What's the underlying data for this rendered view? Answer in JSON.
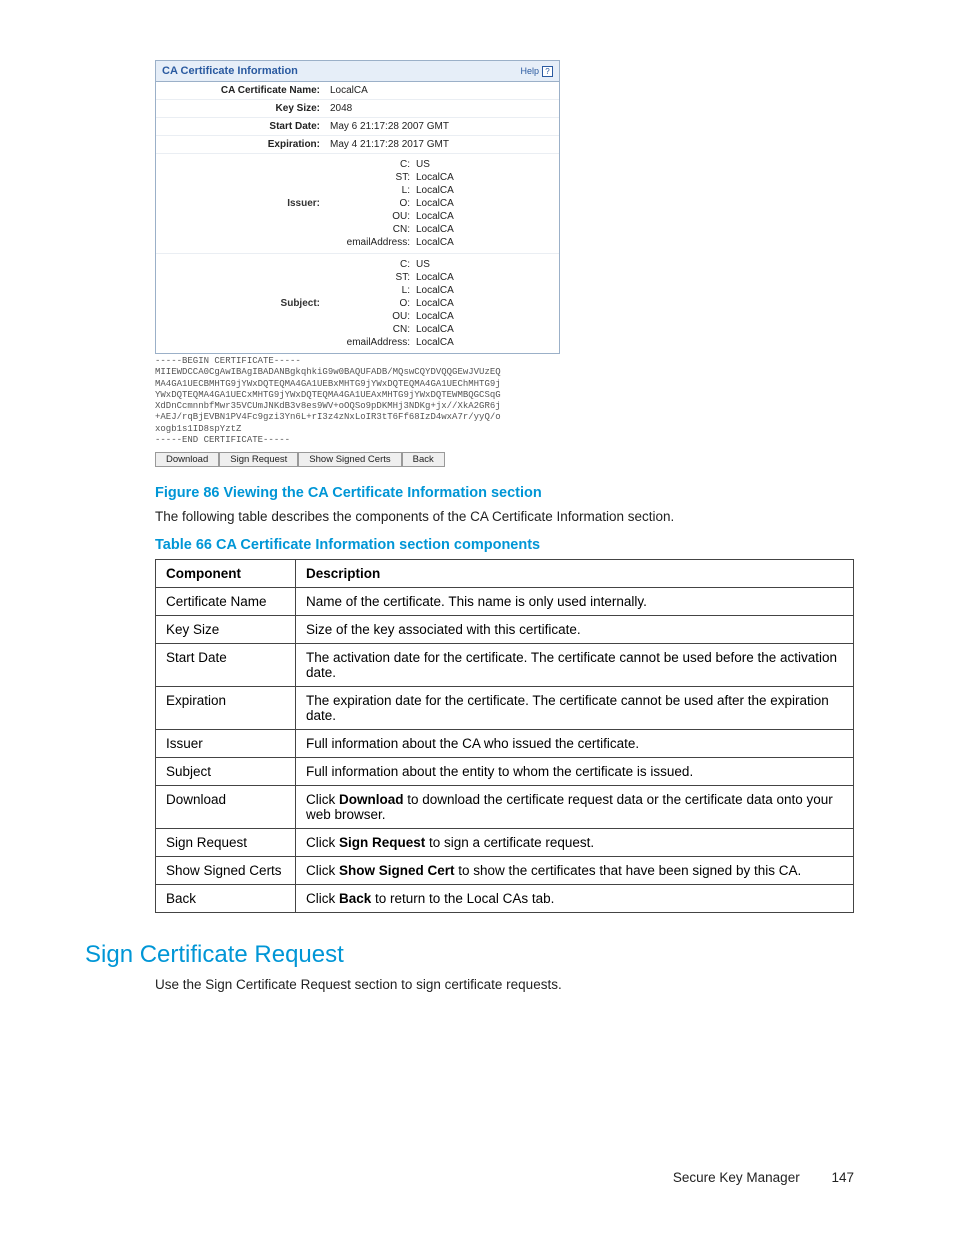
{
  "panel": {
    "title": "CA Certificate Information",
    "help_label": "Help",
    "fields": {
      "name_label": "CA Certificate Name:",
      "name_value": "LocalCA",
      "keysize_label": "Key Size:",
      "keysize_value": "2048",
      "start_label": "Start Date:",
      "start_value": "May  6 21:17:28 2007 GMT",
      "exp_label": "Expiration:",
      "exp_value": "May  4 21:17:28 2017 GMT"
    },
    "issuer_label": "Issuer:",
    "subject_label": "Subject:",
    "dn_labels": {
      "c": "C:",
      "st": "ST:",
      "l": "L:",
      "o": "O:",
      "ou": "OU:",
      "cn": "CN:",
      "email": "emailAddress:"
    },
    "issuer": {
      "c": "US",
      "st": "LocalCA",
      "l": "LocalCA",
      "o": "LocalCA",
      "ou": "LocalCA",
      "cn": "LocalCA",
      "email": "LocalCA"
    },
    "subject": {
      "c": "US",
      "st": "LocalCA",
      "l": "LocalCA",
      "o": "LocalCA",
      "ou": "LocalCA",
      "cn": "LocalCA",
      "email": "LocalCA"
    },
    "cert_text": "-----BEGIN CERTIFICATE-----\nMIIEWDCCA0CgAwIBAgIBADANBgkqhkiG9w0BAQUFADB/MQswCQYDVQQGEwJVUzEQ\nMA4GA1UECBMHTG9jYWxDQTEQMA4GA1UEBxMHTG9jYWxDQTEQMA4GA1UEChMHTG9j\nYWxDQTEQMA4GA1UECxMHTG9jYWxDQTEQMA4GA1UEAxMHTG9jYWxDQTEWMBQGCSqG\nXdDnCcmnnbfMwr35VCUmJNKdB3v8es9WV+oOQSo9pDKMHj3NDKg+jx//XkA2GR6j\n+AEJ/rqBjEVBN1PV4Fc9gzi3Yn6L+rI3z4zNxLoIR3tT6Ff68IzD4wxA7r/yyQ/o\nxogb1s1ID8spYztZ\n-----END CERTIFICATE-----",
    "buttons": {
      "download": "Download",
      "sign": "Sign Request",
      "show": "Show Signed Certs",
      "back": "Back"
    }
  },
  "figure_caption": "Figure 86 Viewing the CA Certificate Information section",
  "intro_text": "The following table describes the components of the CA Certificate Information section.",
  "table_caption": "Table 66 CA Certificate Information section components",
  "table": {
    "head": {
      "c1": "Component",
      "c2": "Description"
    },
    "rows": [
      {
        "c": "Certificate Name",
        "d": "Name of the certificate. This name is only used internally."
      },
      {
        "c": "Key Size",
        "d": "Size of the key associated with this certificate."
      },
      {
        "c": "Start Date",
        "d": "The activation date for the certificate. The certificate cannot be used before the activation date."
      },
      {
        "c": "Expiration",
        "d": "The expiration date for the certificate. The certificate cannot be used after the expiration date."
      },
      {
        "c": "Issuer",
        "d": "Full information about the CA who issued the certificate."
      },
      {
        "c": "Subject",
        "d": "Full information about the entity to whom the certificate is issued."
      },
      {
        "c": "Download",
        "d": "Click <b>Download</b> to download the certificate request data or the certificate data onto your web browser."
      },
      {
        "c": "Sign Request",
        "d": "Click <b>Sign Request</b> to sign a certificate request."
      },
      {
        "c": "Show Signed Certs",
        "d": "Click <b>Show Signed Cert</b> to show the certificates that have been signed by this CA."
      },
      {
        "c": "Back",
        "d": "Click <b>Back</b> to return to the Local CAs tab."
      }
    ]
  },
  "section_heading": "Sign Certificate Request",
  "section_text": "Use the Sign Certificate Request section to sign certificate requests.",
  "footer": {
    "title": "Secure Key Manager",
    "page": "147"
  }
}
